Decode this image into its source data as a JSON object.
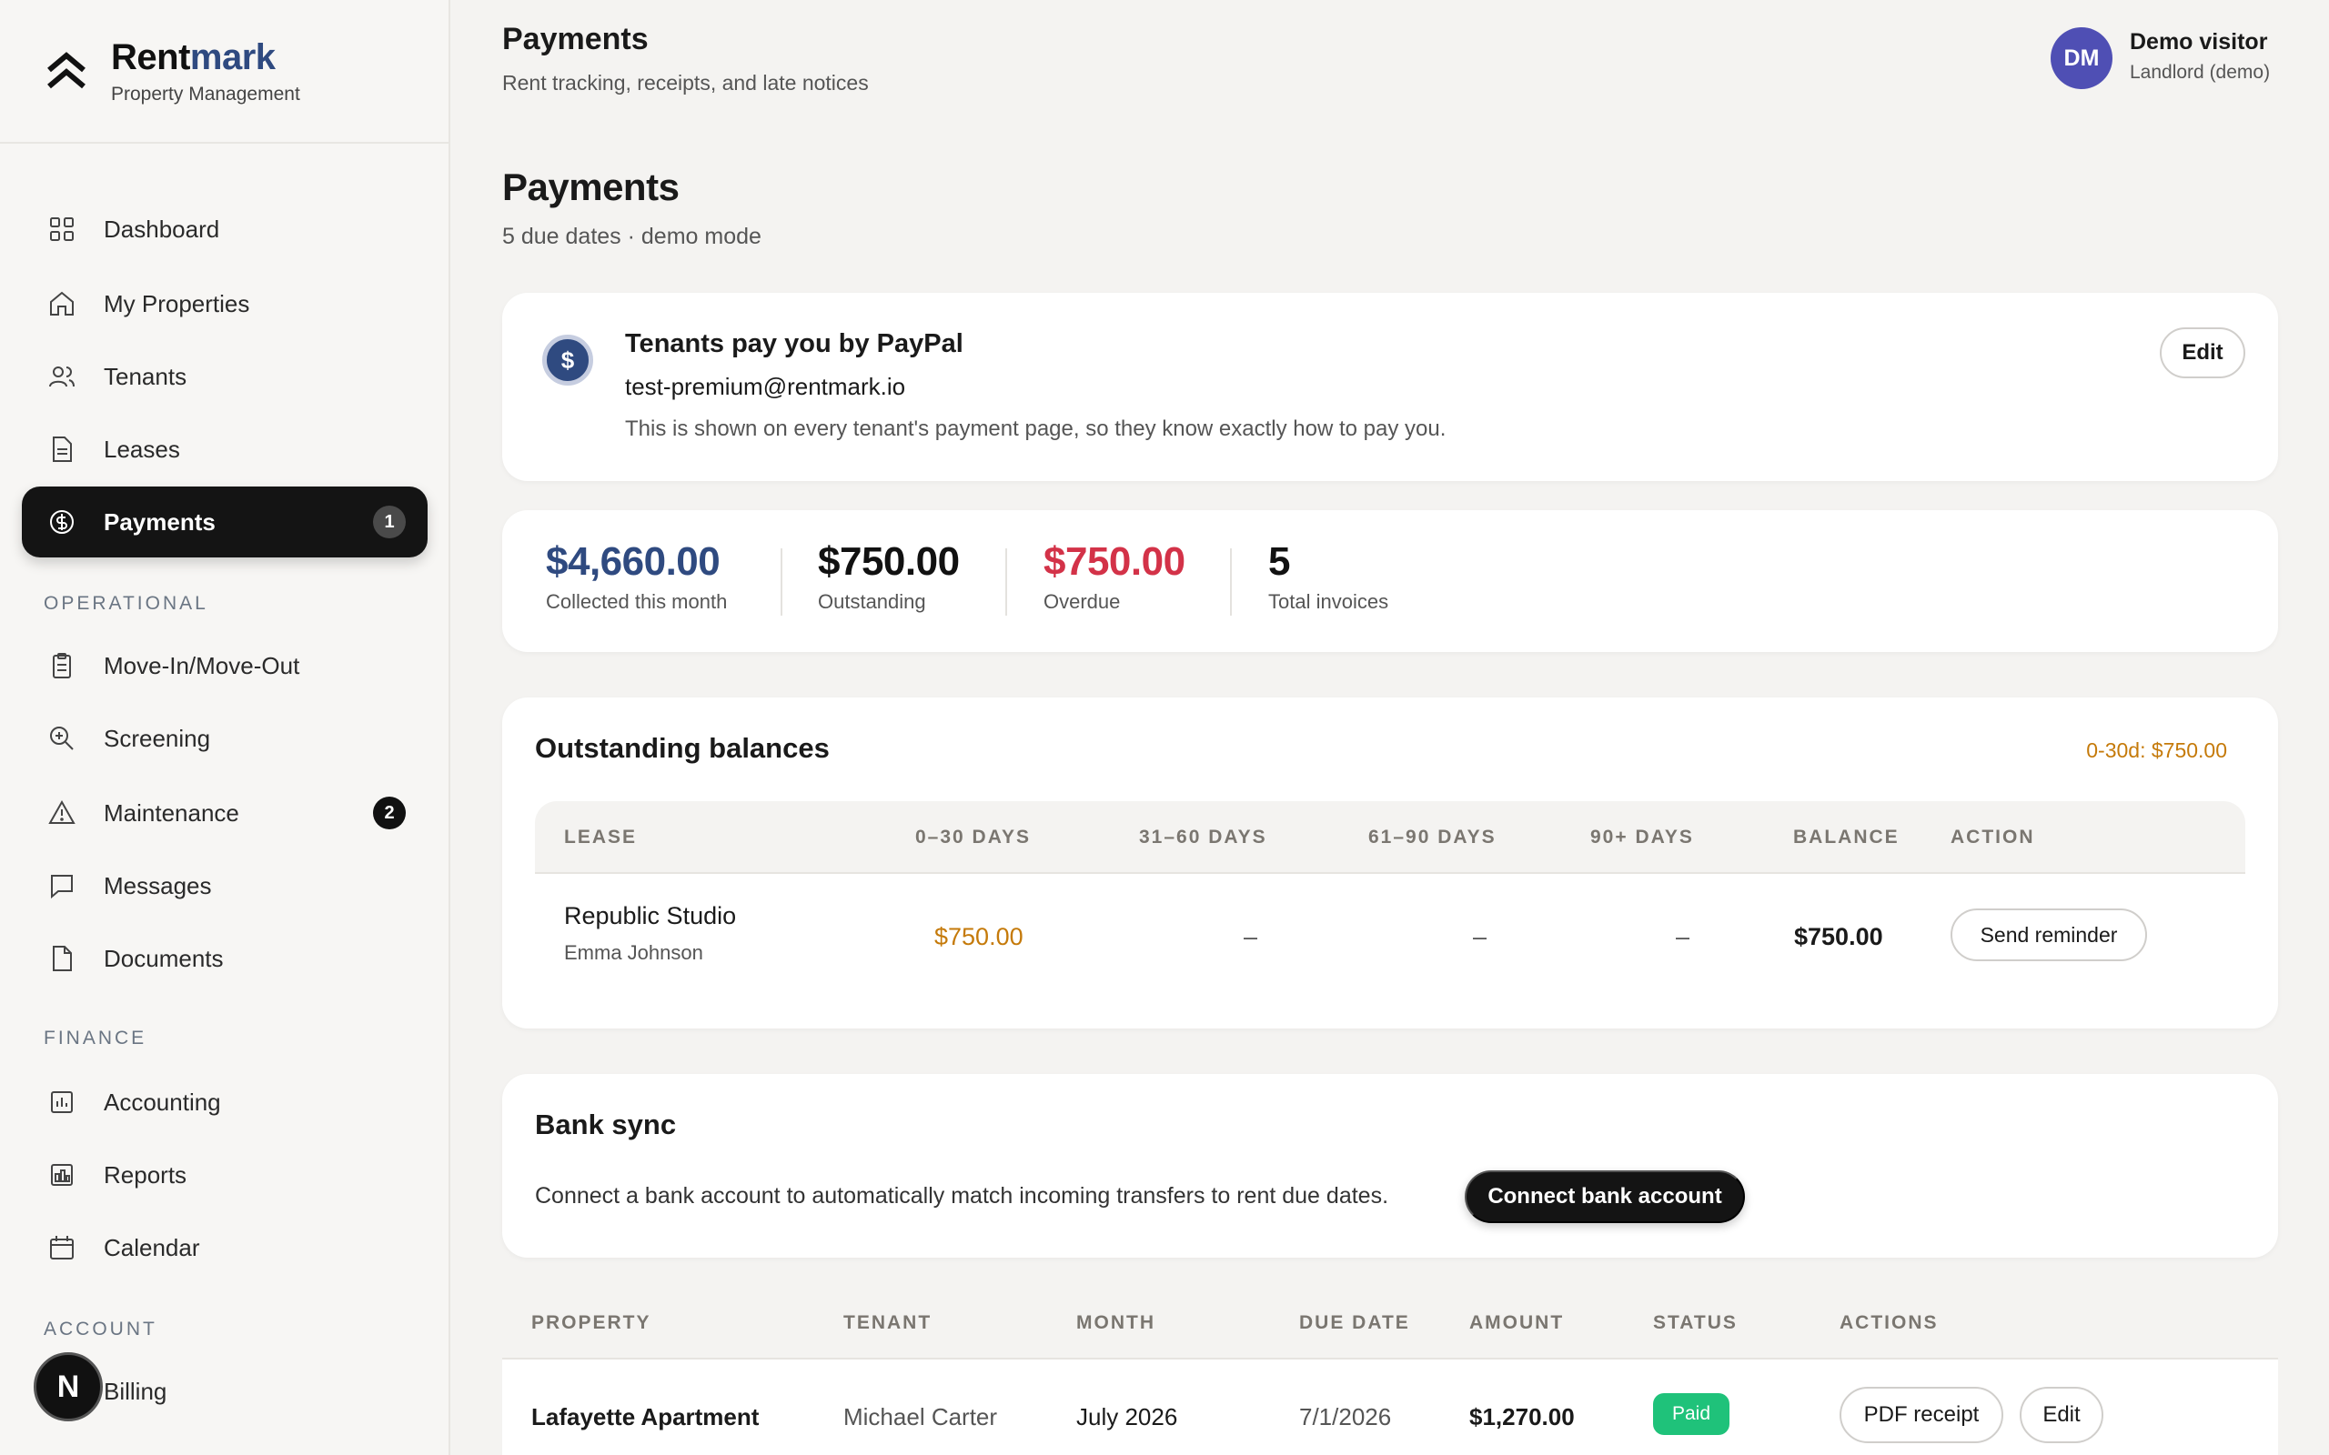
{
  "brand": {
    "name_part1": "Rent",
    "name_part2": "mark",
    "subtitle": "Property Management"
  },
  "sidebar": {
    "items": [
      {
        "label": "Dashboard",
        "icon": "grid-icon"
      },
      {
        "label": "My Properties",
        "icon": "home-icon"
      },
      {
        "label": "Tenants",
        "icon": "users-icon"
      },
      {
        "label": "Leases",
        "icon": "file-text-icon"
      },
      {
        "label": "Payments",
        "icon": "dollar-circle-icon",
        "badge": "1",
        "active": true
      }
    ],
    "sections": {
      "operational": "OPERATIONAL",
      "finance": "FINANCE",
      "account": "ACCOUNT"
    },
    "operational_items": [
      {
        "label": "Move-In/Move-Out",
        "icon": "clipboard-icon"
      },
      {
        "label": "Screening",
        "icon": "zoom-in-icon"
      },
      {
        "label": "Maintenance",
        "icon": "alert-triangle-icon",
        "badge": "2"
      },
      {
        "label": "Messages",
        "icon": "message-icon"
      },
      {
        "label": "Documents",
        "icon": "document-icon"
      }
    ],
    "finance_items": [
      {
        "label": "Accounting",
        "icon": "bar-chart-icon"
      },
      {
        "label": "Reports",
        "icon": "report-chart-icon"
      },
      {
        "label": "Calendar",
        "icon": "calendar-icon"
      }
    ],
    "account_items": [
      {
        "label": "Billing",
        "icon": "credit-card-icon"
      }
    ],
    "fab_label": "N"
  },
  "header": {
    "title": "Payments",
    "subtitle": "Rent tracking, receipts, and late notices",
    "user": {
      "initials": "DM",
      "name": "Demo visitor",
      "role": "Landlord (demo)"
    }
  },
  "main": {
    "title": "Payments",
    "subtitle": "5 due dates · demo mode",
    "paypal": {
      "title": "Tenants pay you by PayPal",
      "email": "test-premium@rentmark.io",
      "note": "This is shown on every tenant's payment page, so they know exactly how to pay you.",
      "edit_label": "Edit"
    },
    "stats": [
      {
        "value": "$4,660.00",
        "label": "Collected this month",
        "color": "#2f4a80"
      },
      {
        "value": "$750.00",
        "label": "Outstanding",
        "color": "#111111"
      },
      {
        "value": "$750.00",
        "label": "Overdue",
        "color": "#d33248"
      },
      {
        "value": "5",
        "label": "Total invoices",
        "color": "#111111"
      }
    ],
    "outstanding": {
      "title": "Outstanding balances",
      "summary": "0-30d: $750.00",
      "columns": [
        "LEASE",
        "0–30 DAYS",
        "31–60 DAYS",
        "61–90 DAYS",
        "90+ DAYS",
        "BALANCE",
        "ACTION"
      ],
      "rows": [
        {
          "lease": "Republic Studio",
          "tenant": "Emma Johnson",
          "d0_30": "$750.00",
          "d31_60": "–",
          "d61_90": "–",
          "d90": "–",
          "balance": "$750.00",
          "action": "Send reminder"
        }
      ]
    },
    "bank_sync": {
      "title": "Bank sync",
      "text": "Connect a bank account to automatically match incoming transfers to rent due dates.",
      "button": "Connect bank account"
    },
    "payments_table": {
      "columns": [
        "PROPERTY",
        "TENANT",
        "MONTH",
        "DUE DATE",
        "AMOUNT",
        "STATUS",
        "ACTIONS"
      ],
      "rows": [
        {
          "property": "Lafayette Apartment",
          "tenant": "Michael Carter",
          "month": "July 2026",
          "due_date": "7/1/2026",
          "amount": "$1,270.00",
          "status": "Paid",
          "pdf": "PDF receipt",
          "edit": "Edit"
        }
      ]
    }
  },
  "colors": {
    "accent": "#2f4a80",
    "overdue": "#d33248",
    "amber": "#c57a0a",
    "paid": "#1fc27a",
    "dark": "#141414"
  }
}
